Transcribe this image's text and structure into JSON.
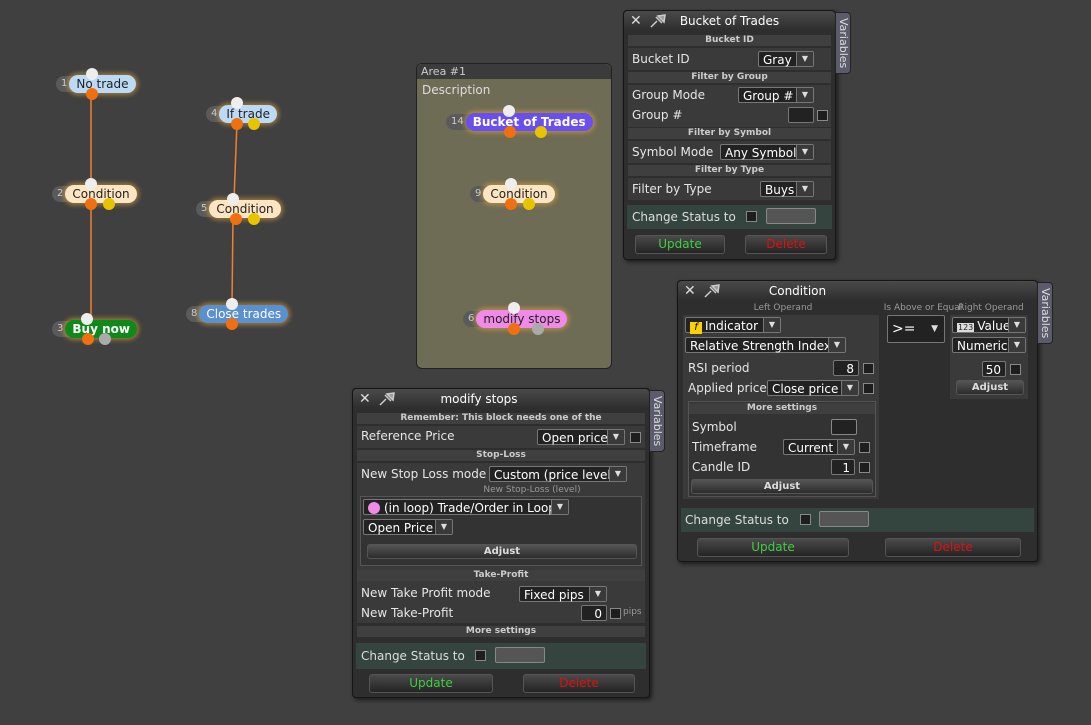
{
  "nodes": {
    "n1": {
      "num": "1",
      "label": "No trade",
      "bg": "#bcd9f5",
      "fg": "#222"
    },
    "n2": {
      "num": "2",
      "label": "Condition",
      "bg": "#fbe5c2",
      "fg": "#222"
    },
    "n3": {
      "num": "3",
      "label": "Buy now",
      "bg": "#0e8a1a",
      "fg": "#fff"
    },
    "n4": {
      "num": "4",
      "label": "If trade",
      "bg": "#bcd9f5",
      "fg": "#222"
    },
    "n5": {
      "num": "5",
      "label": "Condition",
      "bg": "#fbe5c2",
      "fg": "#222"
    },
    "n8": {
      "num": "8",
      "label": "Close trades",
      "bg": "#5a8fd0",
      "fg": "#fff"
    },
    "n14": {
      "num": "14",
      "label": "Bucket of Trades",
      "bg": "#6a4ff0",
      "fg": "#fff"
    },
    "n9": {
      "num": "9",
      "label": "Condition",
      "bg": "#fbe5c2",
      "fg": "#222"
    },
    "n6": {
      "num": "6",
      "label": "modify stops",
      "bg": "#f08ae8",
      "fg": "#222"
    }
  },
  "area": {
    "title": "Area #1",
    "description": "Description"
  },
  "bucket_panel": {
    "title": "Bucket of Trades",
    "variables_tab": "Variables",
    "sec_bucket_id": "Bucket ID",
    "bucket_id_label": "Bucket ID",
    "bucket_id_value": "Gray",
    "sec_filter_group": "Filter by Group",
    "group_mode_label": "Group Mode",
    "group_mode_value": "Group #",
    "group_num_label": "Group #",
    "sec_filter_symbol": "Filter by Symbol",
    "symbol_mode_label": "Symbol Mode",
    "symbol_mode_value": "Any Symbol",
    "sec_filter_type": "Filter by Type",
    "filter_type_label": "Filter by Type",
    "filter_type_value": "Buys",
    "change_status_label": "Change Status to",
    "update_label": "Update",
    "delete_label": "Delete"
  },
  "condition_panel": {
    "title": "Condition",
    "variables_tab": "Variables",
    "left_operand": "Left Operand",
    "operator_caption": "Is Above or Equal",
    "right_operand": "Right Operand",
    "left_type": "Indicator",
    "indicator_name": "Relative Strength Index",
    "rsi_period_label": "RSI period",
    "rsi_period_value": "8",
    "applied_price_label": "Applied price",
    "applied_price_value": "Close price",
    "more_settings": "More settings",
    "symbol_label": "Symbol",
    "timeframe_label": "Timeframe",
    "timeframe_value": "Current",
    "candle_id_label": "Candle ID",
    "candle_id_value": "1",
    "adjust_label": "Adjust",
    "operator_value": ">=",
    "right_type": "Value",
    "right_format": "Numeric",
    "right_value": "50",
    "right_adjust": "Adjust",
    "change_status_label": "Change Status to",
    "update_label": "Update",
    "delete_label": "Delete"
  },
  "modify_panel": {
    "title": "modify stops",
    "variables_tab": "Variables",
    "remember": "Remember: This block needs one of the",
    "ref_price_label": "Reference Price",
    "ref_price_value": "Open price",
    "sec_stoploss": "Stop-Loss",
    "sl_mode_label": "New Stop Loss mode",
    "sl_mode_value": "Custom (price level)",
    "sl_level_caption": "New Stop-Loss (level)",
    "loop_value": "(in loop) Trade/Order in Loop",
    "open_price_value": "Open Price",
    "adjust_label": "Adjust",
    "sec_takeprofit": "Take-Profit",
    "tp_mode_label": "New Take Profit mode",
    "tp_mode_value": "Fixed pips",
    "tp_label": "New Take-Profit",
    "tp_value": "0",
    "tp_unit": "pips",
    "more_settings": "More settings",
    "change_status_label": "Change Status to",
    "update_label": "Update",
    "delete_label": "Delete"
  }
}
